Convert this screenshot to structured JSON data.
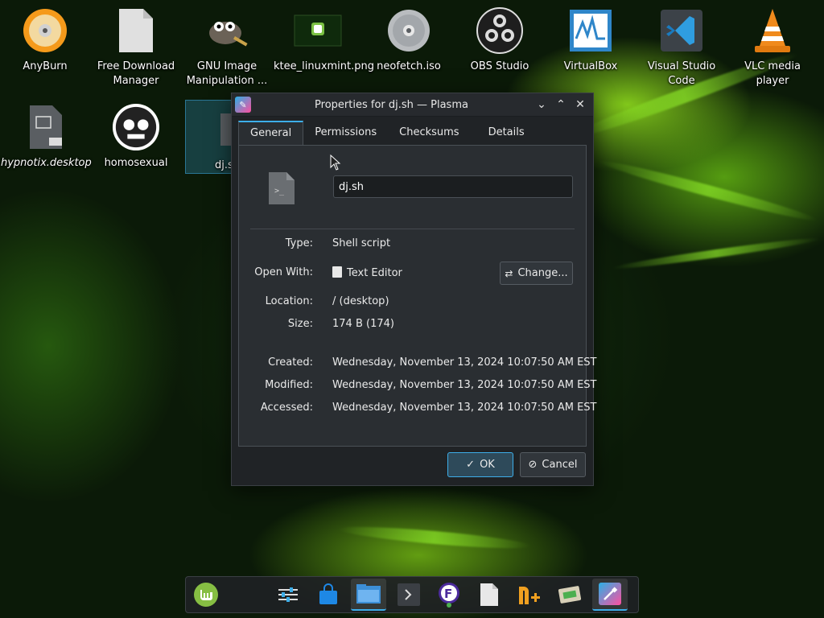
{
  "desktop": {
    "icons": [
      {
        "label": "AnyBurn",
        "icon": "anyburn-icon"
      },
      {
        "label": "Free Download Manager",
        "icon": "file-icon"
      },
      {
        "label": "GNU Image Manipulation ...",
        "icon": "gimp-icon"
      },
      {
        "label": "ktee_linuxmint.png",
        "icon": "image-icon"
      },
      {
        "label": "neofetch.iso",
        "icon": "disc-icon"
      },
      {
        "label": "OBS Studio",
        "icon": "obs-icon"
      },
      {
        "label": "VirtualBox",
        "icon": "virtualbox-icon"
      },
      {
        "label": "Visual Studio Code",
        "icon": "vscode-icon"
      },
      {
        "label": "VLC media player",
        "icon": "vlc-icon"
      },
      {
        "label": "hypnotix.desktop",
        "icon": "desktop-file-icon"
      },
      {
        "label": "homosexual",
        "icon": "image-icon"
      },
      {
        "label": "dj.s",
        "icon": "script-icon"
      }
    ]
  },
  "dialog": {
    "title": "Properties for dj.sh — Plasma",
    "tabs": [
      "General",
      "Permissions",
      "Checksums",
      "Details"
    ],
    "active_tab": "General",
    "file_name": "dj.sh",
    "fields": {
      "type_label": "Type:",
      "type_value": "Shell script",
      "open_with_label": "Open With:",
      "open_with_value": "Text Editor",
      "change_label": "Change...",
      "location_label": "Location:",
      "location_value": "/ (desktop)",
      "size_label": "Size:",
      "size_value": "174 B (174)",
      "created_label": "Created:",
      "created_value": "Wednesday, November 13, 2024 10:07:50 AM EST",
      "modified_label": "Modified:",
      "modified_value": "Wednesday, November 13, 2024 10:07:50 AM EST",
      "accessed_label": "Accessed:",
      "accessed_value": "Wednesday, November 13, 2024 10:07:50 AM EST"
    },
    "ok_label": "OK",
    "cancel_label": "Cancel"
  },
  "taskbar": {
    "items": [
      "mint-menu-icon",
      "settings-icon",
      "store-icon",
      "file-manager-icon",
      "terminal-icon",
      "fdm-icon",
      "document-icon",
      "nplus-icon",
      "disk-usage-icon",
      "plasma-properties-icon"
    ]
  },
  "colors": {
    "accent": "#3daee9",
    "window_bg": "#202326",
    "panel_bg": "#2a2e32"
  }
}
